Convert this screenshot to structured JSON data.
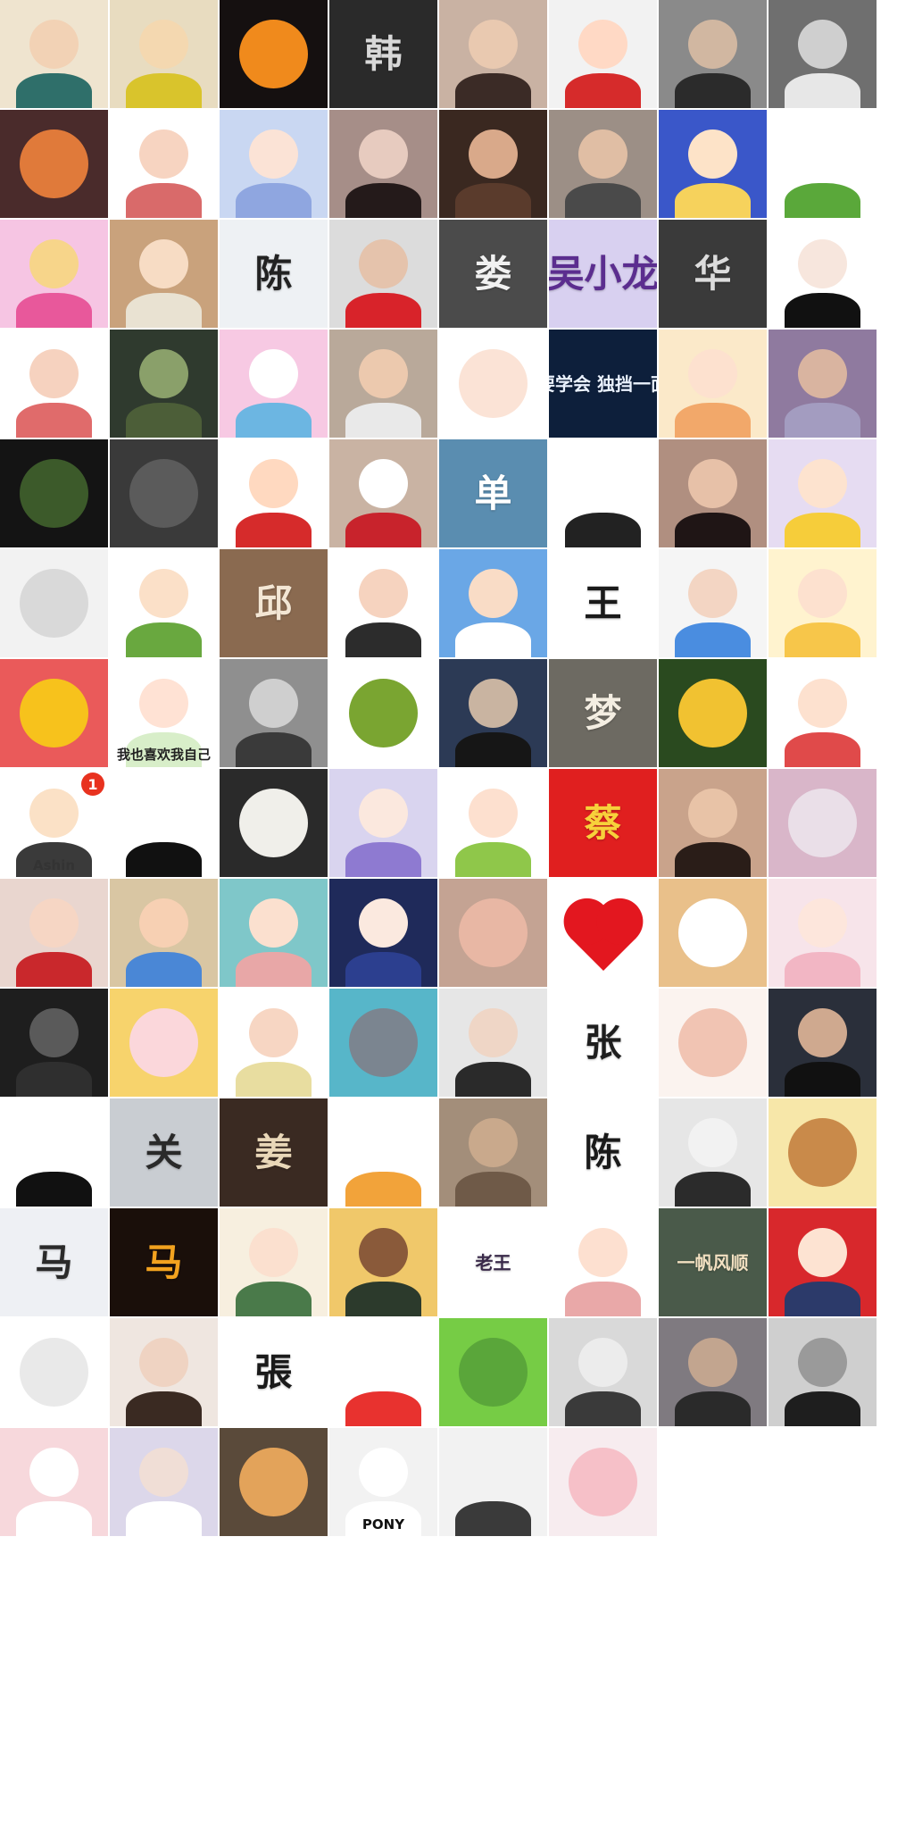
{
  "gallery": {
    "tiles": [
      {
        "name": "avatar-anime-boy-teal-robe",
        "bg": "#efe4cf",
        "motif": "person",
        "face": "#f2d2b5",
        "body": "#2f6f6a"
      },
      {
        "name": "avatar-charlie-brown-cartoon",
        "bg": "#e8dcc0",
        "motif": "person",
        "face": "#f4d8b0",
        "body": "#d9c42c"
      },
      {
        "name": "avatar-fire-flames",
        "bg": "#151010",
        "motif": "disc",
        "disc": "#f08a1c"
      },
      {
        "name": "avatar-han-calligraphy-plaque",
        "bg": "#2a2a2a",
        "motif": "text",
        "text": "韩",
        "color": "#d8d8d8",
        "caption": "",
        "captionColor": "#bbbbbb"
      },
      {
        "name": "avatar-girl-with-teddy-bear",
        "bg": "#c9b2a3",
        "motif": "person",
        "face": "#e9c9b0",
        "body": "#3b2b26"
      },
      {
        "name": "avatar-red-bear-hood-cartoon",
        "bg": "#f2f2f2",
        "motif": "person",
        "face": "#ffd9c5",
        "body": "#d62b2b"
      },
      {
        "name": "avatar-man-in-car-photo",
        "bg": "#8a8a8a",
        "motif": "person",
        "face": "#d1b7a1",
        "body": "#2b2b2b"
      },
      {
        "name": "avatar-bw-wedding-photo",
        "bg": "#6f6f6f",
        "motif": "person",
        "face": "#cfcfcf",
        "body": "#e7e7e7"
      },
      {
        "name": "avatar-car-mirror-sunset",
        "bg": "#4a2b2b",
        "motif": "disc",
        "disc": "#e07a3a"
      },
      {
        "name": "avatar-family-cartoon-hearts",
        "bg": "#ffffff",
        "motif": "person",
        "face": "#f7d4c1",
        "body": "#d96a6a"
      },
      {
        "name": "avatar-anime-blue-hair-girl",
        "bg": "#c9d7f2",
        "motif": "person",
        "face": "#fbe3d6",
        "body": "#8fa6e0"
      },
      {
        "name": "avatar-girl-dark-hair-photo",
        "bg": "#a68e88",
        "motif": "person",
        "face": "#e7cbbf",
        "body": "#241a1a"
      },
      {
        "name": "avatar-woman-side-profile",
        "bg": "#3a2820",
        "motif": "person",
        "face": "#d9a98a",
        "body": "#5a3b2c"
      },
      {
        "name": "avatar-young-man-portrait",
        "bg": "#9c8f86",
        "motif": "person",
        "face": "#e0bea4",
        "body": "#4a4a4a"
      },
      {
        "name": "avatar-princess-cartoon-blue",
        "bg": "#3a57c9",
        "motif": "person",
        "face": "#fde3c8",
        "body": "#f6d25c"
      },
      {
        "name": "avatar-green-hair-sketch",
        "bg": "#ffffff",
        "motif": "person",
        "face": "#ffffff",
        "body": "#5aa83a"
      },
      {
        "name": "avatar-cartoon-bear-lotus",
        "bg": "#f6c5e3",
        "motif": "person",
        "face": "#f7d58a",
        "body": "#e8589b"
      },
      {
        "name": "avatar-girl-buns-cartoon",
        "bg": "#c9a27c",
        "motif": "person",
        "face": "#f7dcc4",
        "body": "#e9e2d2"
      },
      {
        "name": "avatar-chen-ink-landscape",
        "bg": "#eef1f4",
        "motif": "text",
        "text": "陈",
        "color": "#222222",
        "caption": "",
        "captionColor": "#444444"
      },
      {
        "name": "avatar-red-hoodie-girl-photo",
        "bg": "#dcdcdc",
        "motif": "person",
        "face": "#e5c3ac",
        "body": "#d8232a"
      },
      {
        "name": "avatar-lou-silhouette",
        "bg": "#4b4b4b",
        "motif": "text",
        "text": "娄",
        "color": "#f1f1f1",
        "caption": "",
        "captionColor": "#cccccc"
      },
      {
        "name": "avatar-wu-xiaolong-apple",
        "bg": "#d8d0f0",
        "motif": "text",
        "text": "吴小龙",
        "color": "#5b2d8f",
        "caption": "",
        "captionColor": "#5b2d8f"
      },
      {
        "name": "avatar-hua-calligraphy",
        "bg": "#3a3a3a",
        "motif": "text",
        "text": "华",
        "color": "#dcdcdc",
        "caption": "",
        "captionColor": "#bbbbbb"
      },
      {
        "name": "avatar-girl-black-hair-sketch",
        "bg": "#ffffff",
        "motif": "person",
        "face": "#f7e6dd",
        "body": "#111111"
      },
      {
        "name": "avatar-family-cartoon-two",
        "bg": "#ffffff",
        "motif": "person",
        "face": "#f6d2bf",
        "body": "#e06b6b"
      },
      {
        "name": "avatar-teemo-game-character",
        "bg": "#2f3a2e",
        "motif": "person",
        "face": "#8aa06a",
        "body": "#4c5e38"
      },
      {
        "name": "avatar-cat-girl-pink",
        "bg": "#f7c9e3",
        "motif": "person",
        "face": "#ffffff",
        "body": "#6cb6e2"
      },
      {
        "name": "avatar-blond-man-photo",
        "bg": "#b9a99a",
        "motif": "person",
        "face": "#ecc9ae",
        "body": "#e9e9e9"
      },
      {
        "name": "avatar-smiling-face-lineart",
        "bg": "#ffffff",
        "motif": "disc",
        "disc": "#fbe3d6"
      },
      {
        "name": "avatar-learn-to-stand-alone-text",
        "bg": "#0d1f3b",
        "motif": "text",
        "text": "要学会 独挡一面",
        "color": "#eaf2ff",
        "caption": "",
        "captionColor": "#eaf2ff",
        "size": "small"
      },
      {
        "name": "avatar-anime-girl-surprised",
        "bg": "#fbe9c9",
        "motif": "person",
        "face": "#fde1cf",
        "body": "#f2a86a"
      },
      {
        "name": "avatar-girl-headscarf-photo",
        "bg": "#8f7a9f",
        "motif": "person",
        "face": "#d9b4a0",
        "body": "#a39cc0"
      },
      {
        "name": "avatar-bamboo-night-scene",
        "bg": "#141414",
        "motif": "disc",
        "disc": "#3c5a2a"
      },
      {
        "name": "avatar-cat-christmas-hat",
        "bg": "#3a3a3a",
        "motif": "disc",
        "disc": "#5b5b5b"
      },
      {
        "name": "avatar-cartoon-couple-red",
        "bg": "#ffffff",
        "motif": "person",
        "face": "#ffd9c0",
        "body": "#d62b2b"
      },
      {
        "name": "avatar-kitten-santa-hat",
        "bg": "#c9b3a3",
        "motif": "person",
        "face": "#ffffff",
        "body": "#c8232c"
      },
      {
        "name": "avatar-dan-heart-calligraphy",
        "bg": "#5a8db0",
        "motif": "text",
        "text": "单",
        "color": "#ffffff",
        "caption": "",
        "captionColor": "#ffffff"
      },
      {
        "name": "avatar-girl-lineart-plant",
        "bg": "#ffffff",
        "motif": "person",
        "face": "#ffffff",
        "body": "#222222"
      },
      {
        "name": "avatar-woman-smiling-photo",
        "bg": "#b08f80",
        "motif": "person",
        "face": "#e7c1a8",
        "body": "#1f1515"
      },
      {
        "name": "avatar-sailor-moon",
        "bg": "#e6dcf2",
        "motif": "person",
        "face": "#fde3cf",
        "body": "#f6cd3a"
      },
      {
        "name": "avatar-fountain-pen-signature",
        "bg": "#f2f2f2",
        "motif": "disc",
        "disc": "#d9d9d9"
      },
      {
        "name": "avatar-boy-plant-head-cartoon",
        "bg": "#ffffff",
        "motif": "person",
        "face": "#fbe0c8",
        "body": "#69a83f"
      },
      {
        "name": "avatar-qiu-wood-calligraphy",
        "bg": "#8a6a50",
        "motif": "text",
        "text": "邱",
        "color": "#f3e6d4",
        "caption": "",
        "captionColor": "#f3e6d4"
      },
      {
        "name": "avatar-couple-cartoon",
        "bg": "#ffffff",
        "motif": "person",
        "face": "#f6d3bf",
        "body": "#2c2c2c"
      },
      {
        "name": "avatar-girl-blue-sky",
        "bg": "#6aa7e6",
        "motif": "person",
        "face": "#f9dcc6",
        "body": "#ffffff"
      },
      {
        "name": "avatar-wang-ink-circle",
        "bg": "#ffffff",
        "motif": "text",
        "text": "王",
        "color": "#1a1a1a",
        "caption": "",
        "captionColor": "#1a1a1a"
      },
      {
        "name": "avatar-elderly-couple-cartoon",
        "bg": "#f5f5f5",
        "motif": "person",
        "face": "#f3d5c3",
        "body": "#4a8de0"
      },
      {
        "name": "avatar-yellow-bear-hood-girl",
        "bg": "#fff3cf",
        "motif": "person",
        "face": "#fde1cf",
        "body": "#f7c64a"
      },
      {
        "name": "avatar-cartoon-sun",
        "bg": "#ea5a5a",
        "motif": "disc",
        "disc": "#f7c21c"
      },
      {
        "name": "avatar-i-also-like-myself",
        "bg": "#ffffff",
        "motif": "person",
        "face": "#ffe2d4",
        "body": "#d8eec9",
        "caption": "我也喜欢我自己",
        "captionColor": "#222222"
      },
      {
        "name": "avatar-man-bw-photo",
        "bg": "#8f8f8f",
        "motif": "person",
        "face": "#cfcfcf",
        "body": "#3a3a3a"
      },
      {
        "name": "avatar-green-dragon-figure",
        "bg": "#ffffff",
        "motif": "disc",
        "disc": "#7aa531"
      },
      {
        "name": "avatar-man-city-night",
        "bg": "#2c3a55",
        "motif": "person",
        "face": "#c9b4a1",
        "body": "#161616"
      },
      {
        "name": "avatar-dream-sunset-silhouette",
        "bg": "#6d6a62",
        "motif": "text",
        "text": "梦",
        "color": "#f4eee2",
        "caption": "",
        "captionColor": "#f4eee2"
      },
      {
        "name": "avatar-yellow-flowers",
        "bg": "#2a4a1f",
        "motif": "disc",
        "disc": "#f1c231"
      },
      {
        "name": "avatar-red-hat-child-cartoon",
        "bg": "#ffffff",
        "motif": "person",
        "face": "#fde1cf",
        "body": "#e04a4a"
      },
      {
        "name": "avatar-ashin-cartoon-badge",
        "bg": "#ffffff",
        "motif": "person",
        "face": "#fbe1c6",
        "body": "#3a3a3a",
        "badge": "1",
        "caption": "Ashin",
        "captionColor": "#333333"
      },
      {
        "name": "avatar-glasses-man-lineart",
        "bg": "#ffffff",
        "motif": "person",
        "face": "#ffffff",
        "body": "#111111"
      },
      {
        "name": "avatar-two-white-puppies",
        "bg": "#2a2a2a",
        "motif": "disc",
        "disc": "#f0efea"
      },
      {
        "name": "avatar-anime-purple-hair",
        "bg": "#d9d4ef",
        "motif": "person",
        "face": "#fbe8de",
        "body": "#8e7ad1"
      },
      {
        "name": "avatar-girl-pigtails-cartoon",
        "bg": "#ffffff",
        "motif": "person",
        "face": "#fde0cf",
        "body": "#8fc74a"
      },
      {
        "name": "avatar-cai-red-papercut",
        "bg": "#e01f1f",
        "motif": "text",
        "text": "蔡",
        "color": "#f7d13b",
        "caption": "",
        "captionColor": "#f7d13b"
      },
      {
        "name": "avatar-girl-smiling-photo",
        "bg": "#c9a38b",
        "motif": "person",
        "face": "#e8c3a7",
        "body": "#2a1d18"
      },
      {
        "name": "avatar-girl-with-balloon",
        "bg": "#d9b6c9",
        "motif": "disc",
        "disc": "#eadfe8"
      },
      {
        "name": "avatar-couple-kissing-anime",
        "bg": "#e9d6cf",
        "motif": "person",
        "face": "#f6d6c4",
        "body": "#c9282c"
      },
      {
        "name": "avatar-mother-child-cartoon",
        "bg": "#d9c6a3",
        "motif": "person",
        "face": "#f7d0b3",
        "body": "#4a87d6"
      },
      {
        "name": "avatar-boy-bandage-cartoon",
        "bg": "#7fc7c9",
        "motif": "person",
        "face": "#fbe0cf",
        "body": "#e8a7a7"
      },
      {
        "name": "avatar-anime-flower-crown",
        "bg": "#1f2a5a",
        "motif": "person",
        "face": "#fbe9df",
        "body": "#2c3f8f"
      },
      {
        "name": "avatar-blush-face-closeup",
        "bg": "#c4a393",
        "motif": "disc",
        "disc": "#e8b7a4"
      },
      {
        "name": "avatar-valentines-day-heart",
        "bg": "#ffffff",
        "motif": "heart",
        "disc": "#e3171f"
      },
      {
        "name": "avatar-white-rabbit-cartoon",
        "bg": "#e9c08a",
        "motif": "disc",
        "disc": "#ffffff"
      },
      {
        "name": "avatar-anime-girl-white-hat",
        "bg": "#f7e4ea",
        "motif": "person",
        "face": "#fde6dc",
        "body": "#f2b6c4"
      },
      {
        "name": "avatar-soldier-with-gun",
        "bg": "#1e1e1e",
        "motif": "person",
        "face": "#5a5a5a",
        "body": "#2f2f2f"
      },
      {
        "name": "avatar-pink-pig-cartoon",
        "bg": "#f7d36c",
        "motif": "disc",
        "disc": "#fbd7db"
      },
      {
        "name": "avatar-couple-with-baby-cartoon",
        "bg": "#ffffff",
        "motif": "person",
        "face": "#f7d6c3",
        "body": "#e8dda0"
      },
      {
        "name": "avatar-tom-cat-cartoon",
        "bg": "#57b6c9",
        "motif": "disc",
        "disc": "#7b8590"
      },
      {
        "name": "avatar-girl-black-cap-photo",
        "bg": "#e6e6e6",
        "motif": "person",
        "face": "#efd6c6",
        "body": "#2a2a2a"
      },
      {
        "name": "avatar-zhang-circle-calligraphy",
        "bg": "#ffffff",
        "motif": "text",
        "text": "张",
        "color": "#1e1e1e",
        "caption": "",
        "captionColor": "#555555"
      },
      {
        "name": "avatar-cat-lotus-painting",
        "bg": "#fbf3ef",
        "motif": "disc",
        "disc": "#f1c4b3"
      },
      {
        "name": "avatar-couple-kiss-dark",
        "bg": "#2a2f3a",
        "motif": "person",
        "face": "#cfa98f",
        "body": "#111111"
      },
      {
        "name": "avatar-girl-bun-red-cheeks",
        "bg": "#ffffff",
        "motif": "person",
        "face": "#ffffff",
        "body": "#111111"
      },
      {
        "name": "avatar-wolf-ink-calligraphy",
        "bg": "#c9cdd2",
        "motif": "text",
        "text": "关",
        "color": "#2a2a2a",
        "caption": "",
        "captionColor": "#2a2a2a"
      },
      {
        "name": "avatar-jiang-heart-calligraphy",
        "bg": "#3a2a22",
        "motif": "text",
        "text": "姜",
        "color": "#e9d7b8",
        "caption": "",
        "captionColor": "#e9d7b8"
      },
      {
        "name": "avatar-duck-straw-hat-cartoon",
        "bg": "#ffffff",
        "motif": "person",
        "face": "#ffffff",
        "body": "#f2a33a"
      },
      {
        "name": "avatar-man-hat-sepia",
        "bg": "#a38e7a",
        "motif": "person",
        "face": "#c9a98c",
        "body": "#6f5a48"
      },
      {
        "name": "avatar-chen-ink-figure",
        "bg": "#ffffff",
        "motif": "text",
        "text": "陈",
        "color": "#1a1a1a",
        "caption": "",
        "captionColor": "#333333"
      },
      {
        "name": "avatar-anime-boy-bw-sketch",
        "bg": "#e6e6e6",
        "motif": "person",
        "face": "#f2f2f2",
        "body": "#2b2b2b"
      },
      {
        "name": "avatar-tom-jerry-cartoon",
        "bg": "#f7e7a9",
        "motif": "disc",
        "disc": "#c98a4a"
      },
      {
        "name": "avatar-ma-plum-blossom",
        "bg": "#eef0f4",
        "motif": "text",
        "text": "马",
        "color": "#2a2a2a",
        "caption": "",
        "captionColor": "#333333"
      },
      {
        "name": "avatar-ma-golden-horse",
        "bg": "#1a0f0a",
        "motif": "text",
        "text": "马",
        "color": "#f2a21f",
        "caption": "",
        "captionColor": "#f2a21f"
      },
      {
        "name": "avatar-girl-bunting-cartoon",
        "bg": "#f7efdf",
        "motif": "person",
        "face": "#fbe0cf",
        "body": "#4a7a4a"
      },
      {
        "name": "avatar-bear-cartoon-sitting",
        "bg": "#f0c86a",
        "motif": "person",
        "face": "#8a5a3a",
        "body": "#2c3a2c"
      },
      {
        "name": "avatar-laowang-circle-calligraphy",
        "bg": "#ffffff",
        "motif": "text",
        "text": "老王",
        "color": "#3a2a4a",
        "caption": "",
        "captionColor": "#3a2a4a",
        "size": "small"
      },
      {
        "name": "avatar-girl-pink-hat-cartoon",
        "bg": "#ffffff",
        "motif": "person",
        "face": "#fde0d0",
        "body": "#e9a8a8"
      },
      {
        "name": "avatar-sailing-boat-calligraphy",
        "bg": "#4a5a4a",
        "motif": "text",
        "text": "一帆风顺",
        "color": "#f3e1c2",
        "caption": "",
        "captionColor": "#f3e1c2",
        "size": "small"
      },
      {
        "name": "avatar-girl-santa-hat-cartoon",
        "bg": "#d8282c",
        "motif": "person",
        "face": "#fde3d2",
        "body": "#2c3a6a"
      },
      {
        "name": "avatar-cartoon-boy-grid",
        "bg": "#ffffff",
        "motif": "disc",
        "disc": "#e9e9e9"
      },
      {
        "name": "avatar-girl-long-hair-photo",
        "bg": "#efe6e0",
        "motif": "person",
        "face": "#efd3c2",
        "body": "#3a2a22"
      },
      {
        "name": "avatar-zhang-plum-circle",
        "bg": "#ffffff",
        "motif": "text",
        "text": "張",
        "color": "#1a1a1a",
        "caption": "",
        "captionColor": "#444444"
      },
      {
        "name": "avatar-boy-red-cheeks-lineart",
        "bg": "#ffffff",
        "motif": "person",
        "face": "#ffffff",
        "body": "#e8322f"
      },
      {
        "name": "avatar-green-chat-bubbles",
        "bg": "#76cc45",
        "motif": "disc",
        "disc": "#5aa63a"
      },
      {
        "name": "avatar-boy-cap-k-sketch",
        "bg": "#d9d9d9",
        "motif": "person",
        "face": "#ececec",
        "body": "#3a3a3a"
      },
      {
        "name": "avatar-boy-dusk-silhouette",
        "bg": "#7f7a80",
        "motif": "person",
        "face": "#c2a58f",
        "body": "#2a2a2a"
      },
      {
        "name": "avatar-hidden-face-bw",
        "bg": "#cfcfcf",
        "motif": "person",
        "face": "#9a9a9a",
        "body": "#1e1e1e"
      },
      {
        "name": "avatar-girl-straw-hat-pink",
        "bg": "#f7d8dc",
        "motif": "person",
        "face": "#ffffff",
        "body": "#ffffff"
      },
      {
        "name": "avatar-girl-white-dress-photo",
        "bg": "#dcd7ea",
        "motif": "person",
        "face": "#f0ded6",
        "body": "#ffffff"
      },
      {
        "name": "avatar-orange-cat-photo",
        "bg": "#5a4a3a",
        "motif": "disc",
        "disc": "#e3a35a"
      },
      {
        "name": "avatar-pony-boy-sketch",
        "bg": "#f2f2f2",
        "motif": "person",
        "face": "#ffffff",
        "body": "#ffffff",
        "caption": "PONY",
        "captionColor": "#111111"
      },
      {
        "name": "avatar-glasses-boy-sketch",
        "bg": "#f2f2f2",
        "motif": "person",
        "face": "#f2f2f2",
        "body": "#3a3a3a"
      },
      {
        "name": "avatar-pink-pig-hands",
        "bg": "#f7ecef",
        "motif": "disc",
        "disc": "#f6c0c8"
      }
    ]
  }
}
